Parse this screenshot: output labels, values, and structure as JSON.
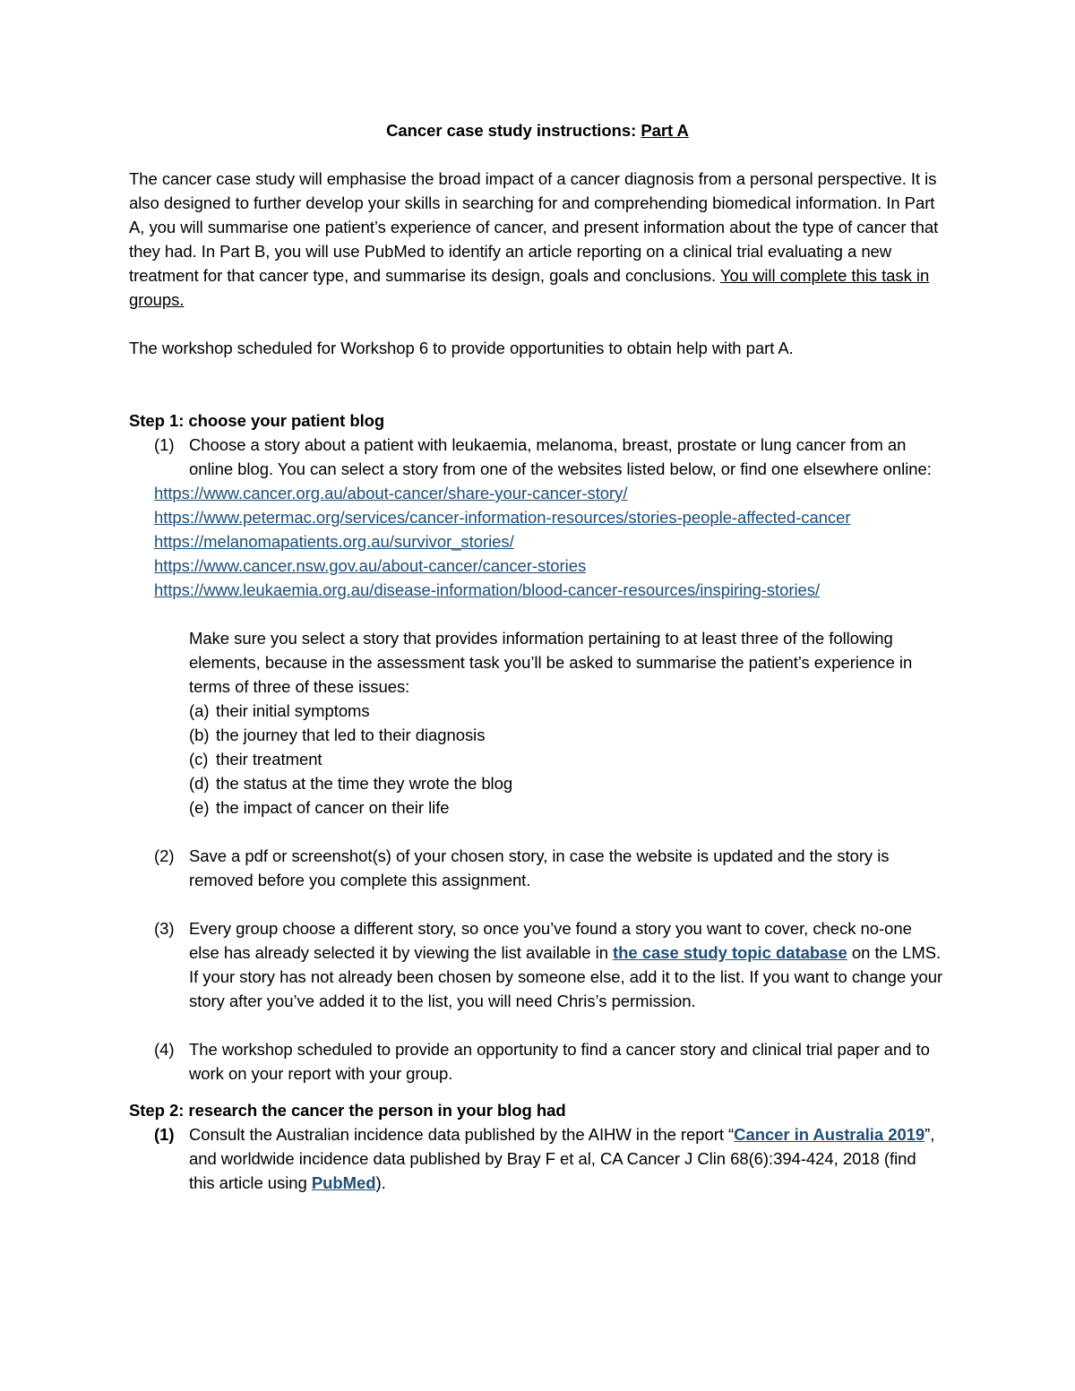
{
  "document": {
    "title_prefix": "Cancer case study instructions: ",
    "title_underlined": "Part A",
    "intro": {
      "text_before_underline": "The cancer case study will emphasise the broad impact of a cancer diagnosis from a personal perspective. It is also designed to further develop your skills in searching for and comprehending biomedical information. In Part A, you will summarise one patient’s experience of cancer, and present information about the type of cancer that they had. In Part B, you will use PubMed to identify an article reporting on a clinical trial evaluating a new treatment for that cancer type, and summarise its design, goals and conclusions.  ",
      "underlined_sentence": "You will complete this task in groups."
    },
    "workshop_note": "The workshop scheduled for Workshop 6 to provide opportunities to obtain help with part A.",
    "step1": {
      "heading": "Step 1: choose your patient blog",
      "item1": {
        "marker": "(1)",
        "text": "Choose a story about a patient with leukaemia, melanoma, breast, prostate or lung cancer from an online blog. You can select a story from one of the websites listed below, or find one elsewhere online:"
      },
      "urls": [
        "https://www.cancer.org.au/about-cancer/share-your-cancer-story/",
        "https://www.petermac.org/services/cancer-information-resources/stories-people-affected-cancer",
        "https://melanomapatients.org.au/survivor_stories/",
        "https://www.cancer.nsw.gov.au/about-cancer/cancer-stories",
        "https://www.leukaemia.org.au/disease-information/blood-cancer-resources/inspiring-stories/"
      ],
      "elements_intro": "Make sure you select a story that provides information pertaining to at least three of the following elements, because in the assessment task you’ll be asked to summarise the patient’s experience in terms of three of these issues:",
      "elements": [
        {
          "marker": "(a)",
          "text": "their initial symptoms"
        },
        {
          "marker": "(b)",
          "text": "the journey that led to their diagnosis"
        },
        {
          "marker": "(c)",
          "text": "their treatment"
        },
        {
          "marker": "(d)",
          "text": "the status at the time they wrote the blog"
        },
        {
          "marker": "(e)",
          "text": "the impact of cancer on their life"
        }
      ],
      "item2": {
        "marker": "(2)",
        "text": "Save a pdf or screenshot(s) of your chosen story, in case the website is updated and the story is removed before you complete this assignment."
      },
      "item3": {
        "marker": "(3)",
        "text_before_link": "Every group choose a different story, so once you’ve found a story you want to cover, check no-one else has already selected it by viewing the list available in ",
        "link_text": "the case study topic database",
        "text_after_link": " on the LMS. If your story has not already been chosen by someone else, add it to the list. If you want to change your story after you’ve added it to the list, you will need Chris’s permission."
      },
      "item4": {
        "marker": "(4)",
        "text": "The workshop scheduled to provide an opportunity to find a cancer story and clinical trial paper and to work on your report with your group."
      }
    },
    "step2": {
      "heading": "Step 2: research the cancer the person in your blog had",
      "item1": {
        "marker": "(1)",
        "text_before_link1": "Consult the Australian incidence data published by the AIHW in the report “",
        "link1_text": "Cancer in Australia 2019",
        "text_between_links": "”, and worldwide incidence data published by Bray F et al, CA Cancer J Clin 68(6):394-424, 2018 (find this article using ",
        "link2_text": "PubMed",
        "text_after_link2": ")."
      }
    },
    "colors": {
      "link": "#1F4E79",
      "text": "#000000",
      "page_background": "#FFFFFF"
    }
  }
}
